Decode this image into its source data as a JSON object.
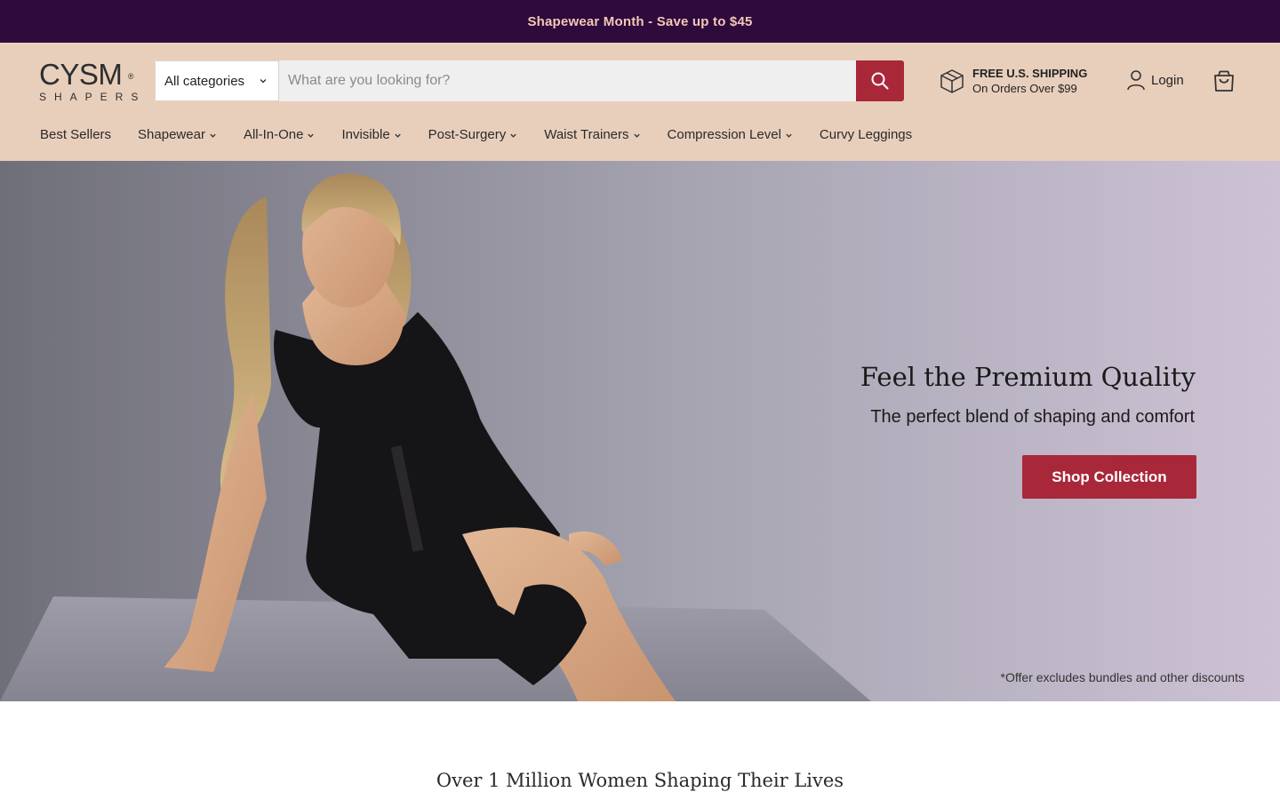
{
  "colors": {
    "announcement_bg": "#2e0a3d",
    "announcement_text": "#f3c9b6",
    "header_bg": "#e8cfbc",
    "accent": "#a8283a",
    "hero_left": "#6f6f7a",
    "hero_right": "#cdc2d5"
  },
  "announcement": {
    "text": "Shapewear Month - Save up to $45"
  },
  "logo": {
    "main": "CYSM",
    "mark": "®",
    "sub": "SHAPERS"
  },
  "search": {
    "category_label": "All categories",
    "placeholder": "What are you looking for?",
    "value": "",
    "button_icon": "search-icon"
  },
  "shipping": {
    "title": "FREE U.S. SHIPPING",
    "subtitle": "On Orders Over $99",
    "icon": "package-icon"
  },
  "account": {
    "login_label": "Login",
    "icon": "user-icon"
  },
  "cart": {
    "icon": "shopping-bag-icon"
  },
  "nav": {
    "items": [
      {
        "label": "Best Sellers",
        "has_dropdown": false
      },
      {
        "label": "Shapewear",
        "has_dropdown": true
      },
      {
        "label": "All-In-One",
        "has_dropdown": true
      },
      {
        "label": "Invisible",
        "has_dropdown": true
      },
      {
        "label": "Post-Surgery",
        "has_dropdown": true
      },
      {
        "label": "Waist Trainers",
        "has_dropdown": true
      },
      {
        "label": "Compression Level",
        "has_dropdown": true
      },
      {
        "label": "Curvy Leggings",
        "has_dropdown": false
      }
    ]
  },
  "hero": {
    "title": "Feel the Premium Quality",
    "subtitle": "The perfect blend of shaping and comfort",
    "cta_label": "Shop Collection",
    "note": "*Offer excludes bundles and other discounts"
  },
  "section": {
    "tagline": "Over 1 Million Women Shaping Their Lives"
  }
}
